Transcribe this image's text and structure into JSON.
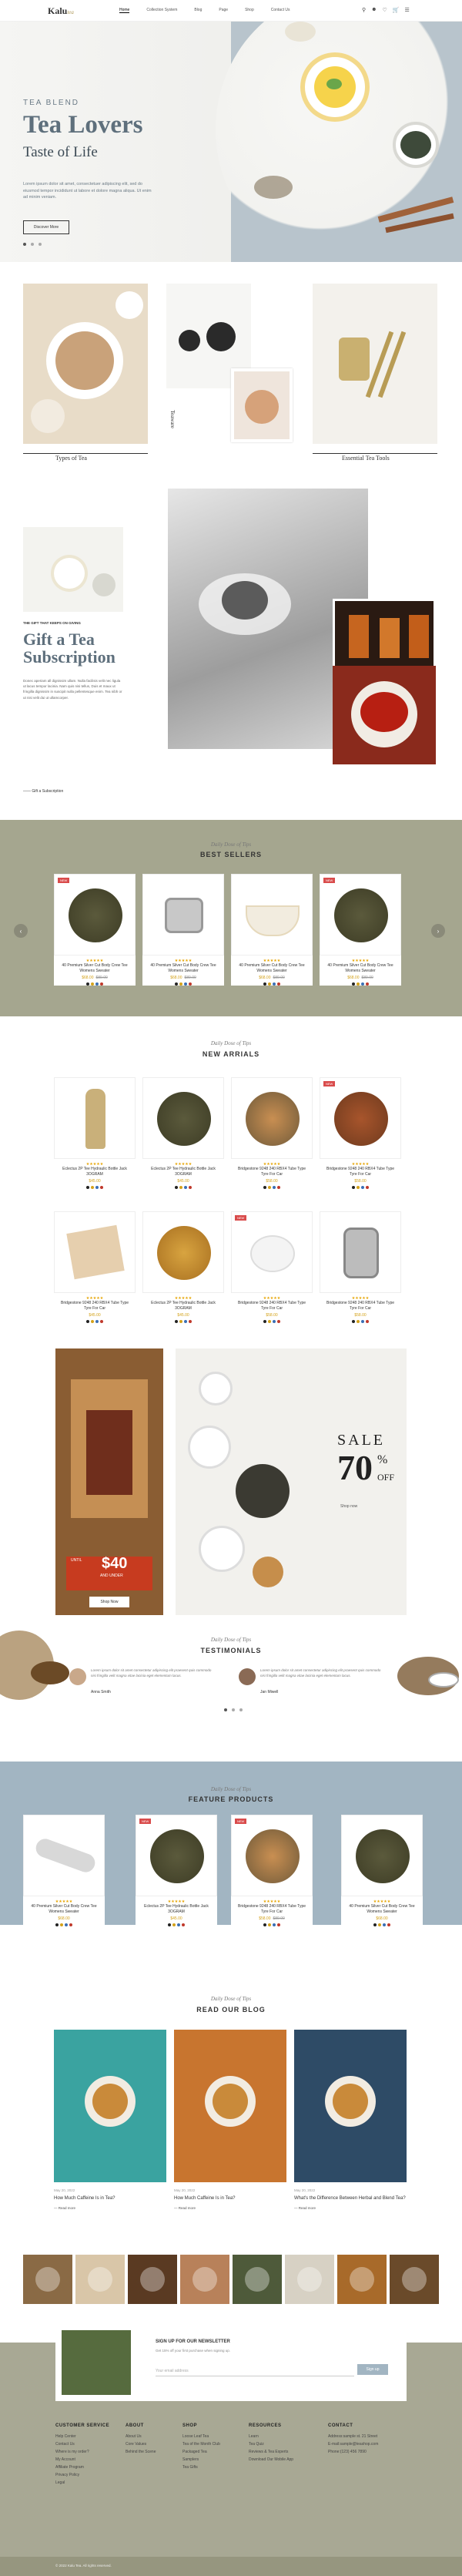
{
  "header": {
    "logo": "Kalu",
    "logo_sub": "tea",
    "nav": [
      "Home",
      "Collection System",
      "Blog",
      "Page",
      "Shop",
      "Contact Us"
    ],
    "cart_count": "0"
  },
  "hero": {
    "tag": "TEA BLEND",
    "title": "Tea Lovers",
    "subtitle": "Taste of Life",
    "desc": "Lorem ipsum dolor sit amet, consectetuer adipiscing elit, sed do eiusmod tempor incididunt ut labore et dolore magna aliqua. Ut enim ad minim veniam.",
    "button": "Discover More"
  },
  "categories": {
    "types": "Types of Tea",
    "teaware": "Teaware",
    "essential": "Essential Tea Tools"
  },
  "gift": {
    "kicker": "THE GIFT THAT KEEPS ON GIVING",
    "title_line1": "Gift a Tea",
    "title_line2": "Subscription",
    "desc": "Donec aperiam all dignissim ullam. Nulla facilisis velit nec ligula ut lacus tempor lacinia. Nam quis nisi tellus, Duis et maux ut fringilla dignissim in suscipit nulla pellentesque enim. Tea nibh or ut nisi velit dui ut ullamcorper.",
    "button": "Gift a Subscription"
  },
  "bestsellers": {
    "script": "Daily Dose of Tips",
    "title": "BEST SELLERS",
    "items": [
      {
        "name": "40 Premium Silver Cut Body Crew Tee Womens Sweater",
        "price": "$68.00",
        "old": "$89.00"
      },
      {
        "name": "40 Premium Silver Cut Body Crew Tee Womens Sweater",
        "price": "$68.00",
        "old": "$89.00"
      },
      {
        "name": "40 Premium Silver Cut Body Crew Tee Womens Sweater",
        "price": "$68.00",
        "old": "$89.00"
      },
      {
        "name": "40 Premium Silver Cut Body Crew Tee Womens Sweater",
        "price": "$68.00",
        "old": "$89.00"
      }
    ]
  },
  "arrivals": {
    "script": "Daily Dose of Tips",
    "title": "NEW ARRIALS",
    "items": [
      {
        "name": "Eclectus 2P Tee Hydraulic Bottle Jack 3OGRAM",
        "price": "$45.00"
      },
      {
        "name": "Eclectus 2P Tee Hydraulic Bottle Jack 3OGRAM",
        "price": "$45.00"
      },
      {
        "name": "Bridgestone 9248 240 RBX4 Tube Type Tyre For Car",
        "price": "$58.00"
      },
      {
        "name": "Bridgestone 9248 240 RBX4 Tube Type Tyre For Car",
        "price": "$58.00"
      },
      {
        "name": "Bridgestone 9248 240 RBX4 Tube Type Tyre For Car",
        "price": "$45.00"
      },
      {
        "name": "Eclectus 2P Tee Hydraulic Bottle Jack 3OGRAM",
        "price": "$45.00"
      },
      {
        "name": "Bridgestone 9248 240 RBX4 Tube Type Tyre For Car",
        "price": "$58.00"
      },
      {
        "name": "Bridgestone 9248 240 RBX4 Tube Type Tyre For Car",
        "price": "$58.00"
      }
    ]
  },
  "promo": {
    "offer_label": "UNTIL",
    "offer_price": "$40",
    "offer_sub": "AND UNDER",
    "shop_btn": "Shop Now",
    "sale": "SALE",
    "percent": "70",
    "percent_sign": "%",
    "off": "OFF",
    "sale_link": "Shop now"
  },
  "testimonials": {
    "script": "Daily Dose of Tips",
    "title": "TESTIMONIALS",
    "items": [
      {
        "text": "Lorem ipsum dolor sit amet consectetur adipiscing elit praesent quis commodo nisi fringilla velit magna vitae lacinia eget elementum lacus.",
        "author": "Anna Smith"
      },
      {
        "text": "Lorem ipsum dolor sit amet consectetur adipiscing elit praesent quis commodo nisi fringilla velit magna vitae lacinia eget elementum lacus.",
        "author": "Jan Miwell"
      }
    ]
  },
  "featured": {
    "script": "Daily Dose of Tips",
    "title": "FEATURE PRODUCTS",
    "items": [
      {
        "name": "40 Premium Silver Cut Body Crew Tee Womens Sweater",
        "price": "$68.00"
      },
      {
        "name": "Eclectus 2P Tee Hydraulic Bottle Jack 3OGRAM",
        "price": "$45.00"
      },
      {
        "name": "Bridgestone 9248 240 RBX4 Tube Type Tyre For Car",
        "price": "$58.00",
        "old": "$89.00"
      },
      {
        "name": "40 Premium Silver Cut Body Crew Tee Womens Sweater",
        "price": "$68.00"
      }
    ]
  },
  "blog": {
    "script": "Daily Dose of Tips",
    "title": "READ OUR BLOG",
    "items": [
      {
        "date": "May 20, 2022",
        "title": "How Much Caffeine Is in Tea?",
        "more": "Read more"
      },
      {
        "date": "May 20, 2022",
        "title": "How Much Caffeine Is in Tea?",
        "more": "Read more"
      },
      {
        "date": "May 20, 2022",
        "title": "What's the Difference Between Herbal and Blend Tea?",
        "more": "Read more"
      }
    ]
  },
  "newsletter": {
    "title": "SIGN UP FOR OUR NEWSLETTER",
    "sub": "Get 15% off your first purchase when signing up.",
    "placeholder": "Your email address",
    "button": "Sign up"
  },
  "footer": {
    "cols": [
      {
        "title": "CUSTOMER SERVICE",
        "links": [
          "Help Center",
          "Contact Us",
          "Where is my order?",
          "My Account",
          "Affiliate Program",
          "Privacy Policy",
          "Legal"
        ]
      },
      {
        "title": "ABOUT",
        "links": [
          "About Us",
          "Core Values",
          "Behind the Scene"
        ]
      },
      {
        "title": "SHOP",
        "links": [
          "Loose Leaf Tea",
          "Tea of the Month Club",
          "Packaged Tea",
          "Samplers",
          "Tea Gifts"
        ]
      },
      {
        "title": "RESOURCES",
        "links": [
          "Learn",
          "Tea Quiz",
          "Reviews & Tea Experts",
          "Download Our Mobile App"
        ]
      },
      {
        "title": "CONTACT",
        "links": [
          "Address:sample st. 21 Street",
          "E-mail:sample@teashop.com",
          "Phone:(123) 456 7890"
        ]
      }
    ],
    "copyright": "© 2022 Kalu Tea. All rights reserved."
  }
}
